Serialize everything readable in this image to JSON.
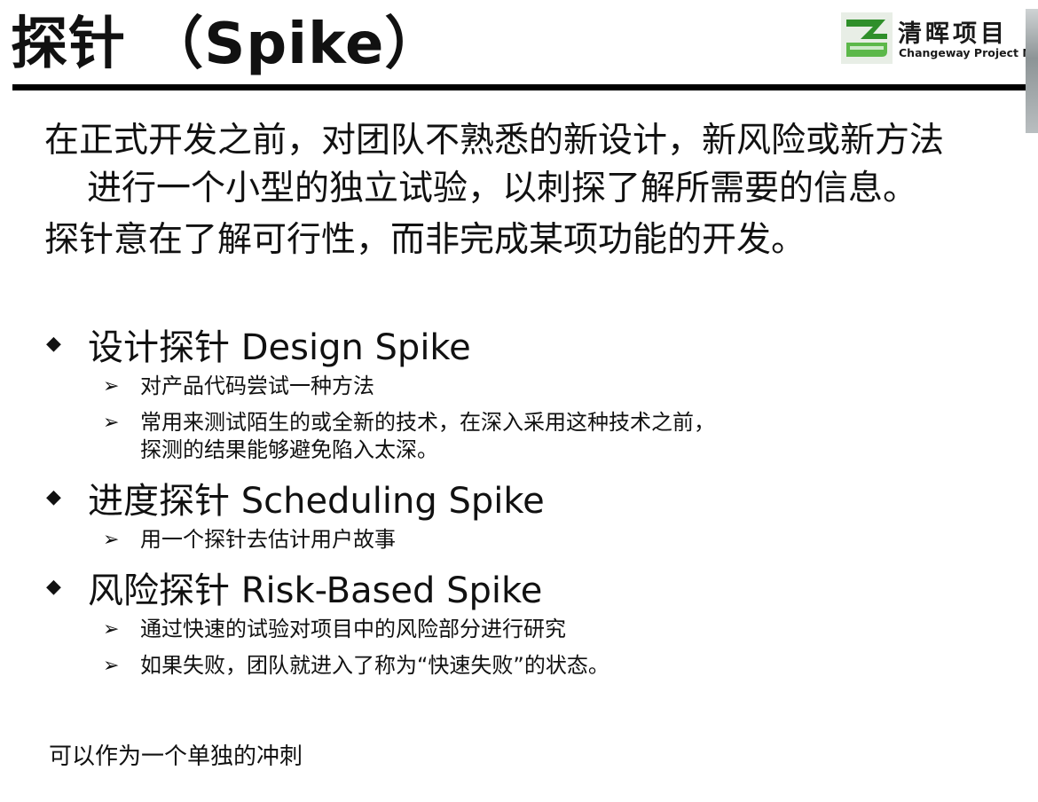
{
  "title": "探针 （Spike）",
  "logo": {
    "cn_text": "清晖项目",
    "en_text": "Changeway Project Ma",
    "mark_icon": "changeway-logo-mark",
    "mark_color": "#3a9a2f"
  },
  "intro": {
    "line1": "在正式开发之前，对团队不熟悉的新设计，新风险或新方法",
    "line2": "进行一个小型的独立试验，以刺探了解所需要的信息。",
    "line3": "探针意在了解可行性，而非完成某项功能的开发。"
  },
  "bullets": [
    {
      "label": "设计探针 Design Spike",
      "subs": [
        "对产品代码尝试一种方法",
        "常用来测试陌生的或全新的技术，在深入采用这种技术之前，\n探测的结果能够避免陷入太深。"
      ]
    },
    {
      "label": "进度探针 Scheduling Spike",
      "subs": [
        "用一个探针去估计用户故事"
      ]
    },
    {
      "label": "风险探针 Risk-Based Spike",
      "subs": [
        "通过快速的试验对项目中的风险部分进行研究",
        "如果失败，团队就进入了称为“快速失败”的状态。"
      ]
    }
  ],
  "bullet_icon": "◆",
  "sub_icon": "➢",
  "footer_note": "可以作为一个单独的冲刺"
}
